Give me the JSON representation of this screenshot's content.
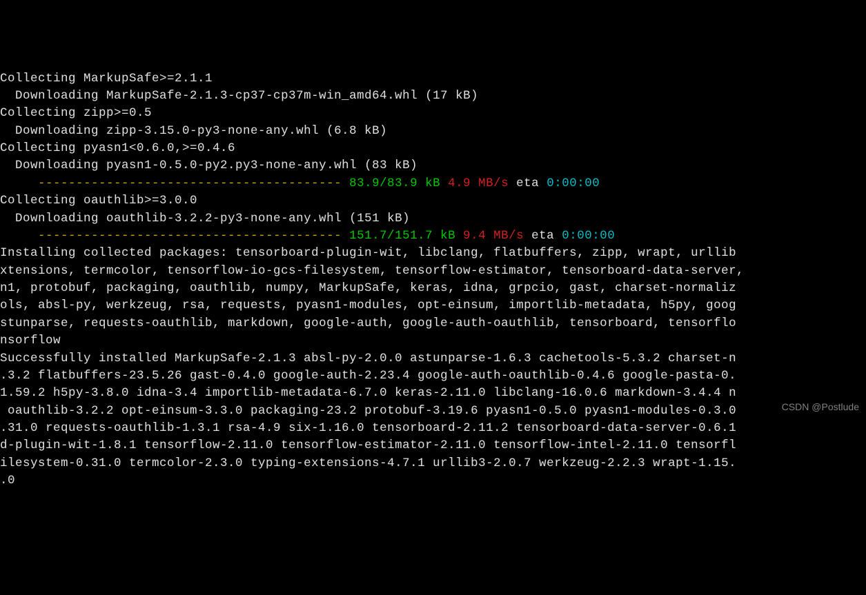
{
  "terminal": {
    "lines": [
      {
        "segments": [
          {
            "text": "Collecting MarkupSafe>=2.1.1",
            "class": "white"
          }
        ]
      },
      {
        "segments": [
          {
            "text": "  Downloading MarkupSafe-2.1.3-cp37-cp37m-win_amd64.whl (17 kB)",
            "class": "white"
          }
        ]
      },
      {
        "segments": [
          {
            "text": "Collecting zipp>=0.5",
            "class": "white"
          }
        ]
      },
      {
        "segments": [
          {
            "text": "  Downloading zipp-3.15.0-py3-none-any.whl (6.8 kB)",
            "class": "white"
          }
        ]
      },
      {
        "segments": [
          {
            "text": "Collecting pyasn1<0.6.0,>=0.4.6",
            "class": "white"
          }
        ]
      },
      {
        "segments": [
          {
            "text": "  Downloading pyasn1-0.5.0-py2.py3-none-any.whl (83 kB)",
            "class": "white"
          }
        ]
      },
      {
        "segments": [
          {
            "text": "     ",
            "class": "white"
          },
          {
            "text": "----------------------------------------",
            "class": "yellow"
          },
          {
            "text": " ",
            "class": "white"
          },
          {
            "text": "83.9/83.9 kB",
            "class": "green"
          },
          {
            "text": " ",
            "class": "white"
          },
          {
            "text": "4.9 MB/s",
            "class": "red"
          },
          {
            "text": " eta ",
            "class": "white"
          },
          {
            "text": "0:00:00",
            "class": "cyan"
          }
        ]
      },
      {
        "segments": [
          {
            "text": "Collecting oauthlib>=3.0.0",
            "class": "white"
          }
        ]
      },
      {
        "segments": [
          {
            "text": "  Downloading oauthlib-3.2.2-py3-none-any.whl (151 kB)",
            "class": "white"
          }
        ]
      },
      {
        "segments": [
          {
            "text": "     ",
            "class": "white"
          },
          {
            "text": "----------------------------------------",
            "class": "yellow"
          },
          {
            "text": " ",
            "class": "white"
          },
          {
            "text": "151.7/151.7 kB",
            "class": "green"
          },
          {
            "text": " ",
            "class": "white"
          },
          {
            "text": "9.4 MB/s",
            "class": "red"
          },
          {
            "text": " eta ",
            "class": "white"
          },
          {
            "text": "0:00:00",
            "class": "cyan"
          }
        ]
      },
      {
        "segments": [
          {
            "text": "Installing collected packages: tensorboard-plugin-wit, libclang, flatbuffers, zipp, wrapt, urllib",
            "class": "white"
          }
        ]
      },
      {
        "segments": [
          {
            "text": "xtensions, termcolor, tensorflow-io-gcs-filesystem, tensorflow-estimator, tensorboard-data-server,",
            "class": "white"
          }
        ]
      },
      {
        "segments": [
          {
            "text": "n1, protobuf, packaging, oauthlib, numpy, MarkupSafe, keras, idna, grpcio, gast, charset-normaliz",
            "class": "white"
          }
        ]
      },
      {
        "segments": [
          {
            "text": "ols, absl-py, werkzeug, rsa, requests, pyasn1-modules, opt-einsum, importlib-metadata, h5py, goog",
            "class": "white"
          }
        ]
      },
      {
        "segments": [
          {
            "text": "stunparse, requests-oauthlib, markdown, google-auth, google-auth-oauthlib, tensorboard, tensorflo",
            "class": "white"
          }
        ]
      },
      {
        "segments": [
          {
            "text": "nsorflow",
            "class": "white"
          }
        ]
      },
      {
        "segments": [
          {
            "text": "Successfully installed MarkupSafe-2.1.3 absl-py-2.0.0 astunparse-1.6.3 cachetools-5.3.2 charset-n",
            "class": "white"
          }
        ]
      },
      {
        "segments": [
          {
            "text": ".3.2 flatbuffers-23.5.26 gast-0.4.0 google-auth-2.23.4 google-auth-oauthlib-0.4.6 google-pasta-0.",
            "class": "white"
          }
        ]
      },
      {
        "segments": [
          {
            "text": "1.59.2 h5py-3.8.0 idna-3.4 importlib-metadata-6.7.0 keras-2.11.0 libclang-16.0.6 markdown-3.4.4 n",
            "class": "white"
          }
        ]
      },
      {
        "segments": [
          {
            "text": " oauthlib-3.2.2 opt-einsum-3.3.0 packaging-23.2 protobuf-3.19.6 pyasn1-0.5.0 pyasn1-modules-0.3.0",
            "class": "white"
          }
        ]
      },
      {
        "segments": [
          {
            "text": ".31.0 requests-oauthlib-1.3.1 rsa-4.9 six-1.16.0 tensorboard-2.11.2 tensorboard-data-server-0.6.1",
            "class": "white"
          }
        ]
      },
      {
        "segments": [
          {
            "text": "d-plugin-wit-1.8.1 tensorflow-2.11.0 tensorflow-estimator-2.11.0 tensorflow-intel-2.11.0 tensorfl",
            "class": "white"
          }
        ]
      },
      {
        "segments": [
          {
            "text": "ilesystem-0.31.0 termcolor-2.3.0 typing-extensions-4.7.1 urllib3-2.0.7 werkzeug-2.2.3 wrapt-1.15.",
            "class": "white"
          }
        ]
      },
      {
        "segments": [
          {
            "text": ".0",
            "class": "white"
          }
        ]
      }
    ]
  },
  "watermark": "CSDN @Postlude"
}
